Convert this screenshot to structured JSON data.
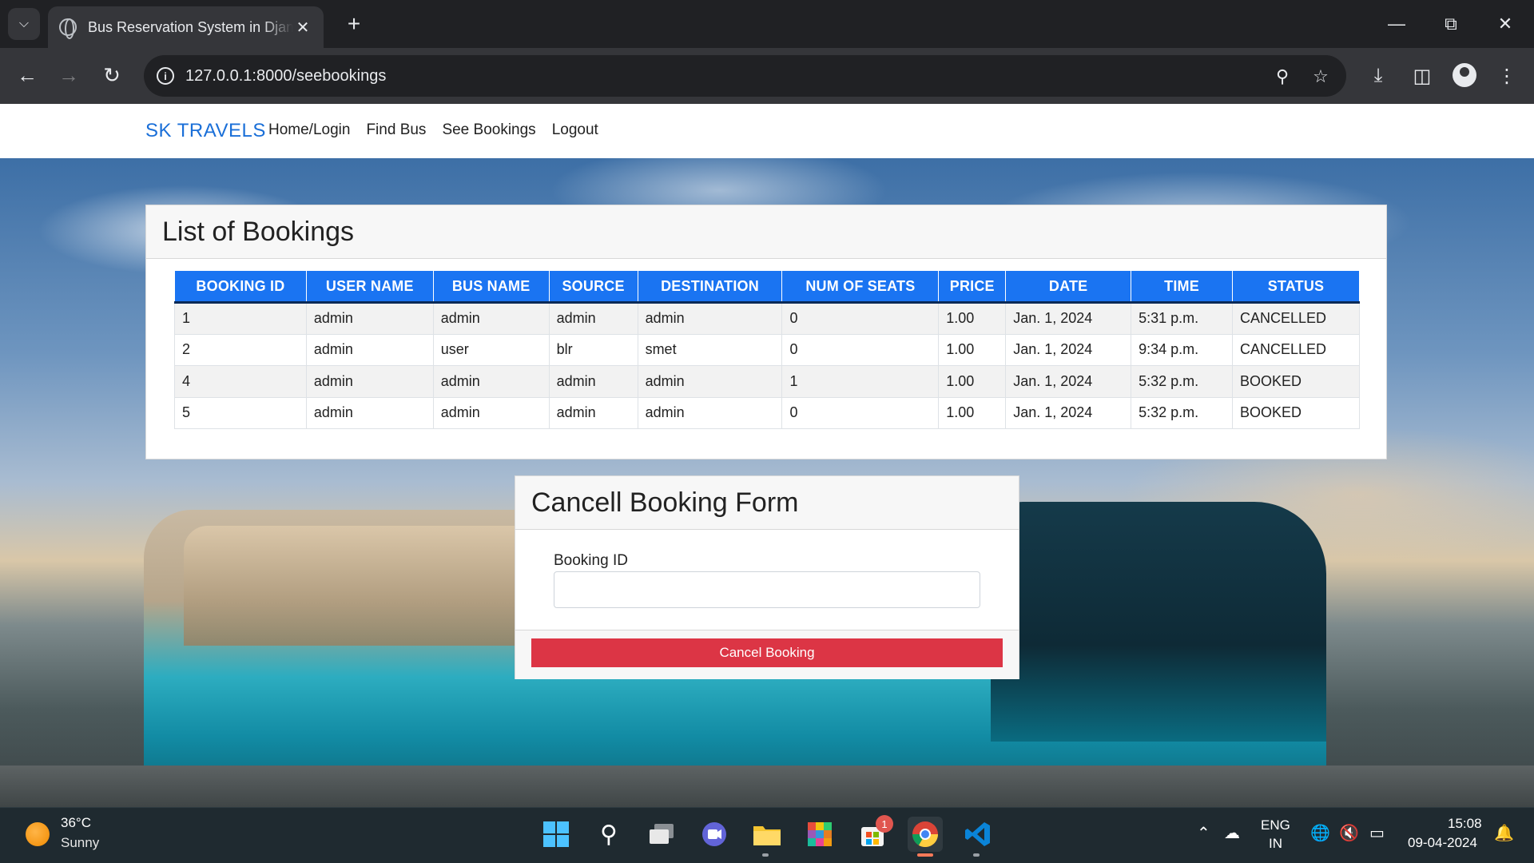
{
  "browser": {
    "tab_title": "Bus Reservation System in Django",
    "new_tab_label": "+",
    "url": "127.0.0.1:8000/seebookings"
  },
  "navbar": {
    "brand": "SK TRAVELS",
    "links": [
      "Home/Login",
      "Find Bus",
      "See Bookings",
      "Logout"
    ]
  },
  "bookings": {
    "heading": "List of Bookings",
    "columns": [
      "BOOKING ID",
      "USER NAME",
      "BUS NAME",
      "SOURCE",
      "DESTINATION",
      "NUM OF SEATS",
      "PRICE",
      "DATE",
      "TIME",
      "STATUS"
    ],
    "rows": [
      [
        "1",
        "admin",
        "admin",
        "admin",
        "admin",
        "0",
        "1.00",
        "Jan. 1, 2024",
        "5:31 p.m.",
        "CANCELLED"
      ],
      [
        "2",
        "admin",
        "user",
        "blr",
        "smet",
        "0",
        "1.00",
        "Jan. 1, 2024",
        "9:34 p.m.",
        "CANCELLED"
      ],
      [
        "4",
        "admin",
        "admin",
        "admin",
        "admin",
        "1",
        "1.00",
        "Jan. 1, 2024",
        "5:32 p.m.",
        "BOOKED"
      ],
      [
        "5",
        "admin",
        "admin",
        "admin",
        "admin",
        "0",
        "1.00",
        "Jan. 1, 2024",
        "5:32 p.m.",
        "BOOKED"
      ]
    ]
  },
  "cancel_form": {
    "heading": "Cancell Booking Form",
    "field_label": "Booking ID",
    "field_value": "",
    "button_label": "Cancel Booking"
  },
  "colors": {
    "brand": "#1a6fd8",
    "table_header": "#1a74f2",
    "danger_button": "#dc3545"
  },
  "taskbar": {
    "weather_temp": "36°C",
    "weather_condition": "Sunny",
    "notification_badge": "1",
    "lang_primary": "ENG",
    "lang_secondary": "IN",
    "time": "15:08",
    "date": "09-04-2024"
  }
}
